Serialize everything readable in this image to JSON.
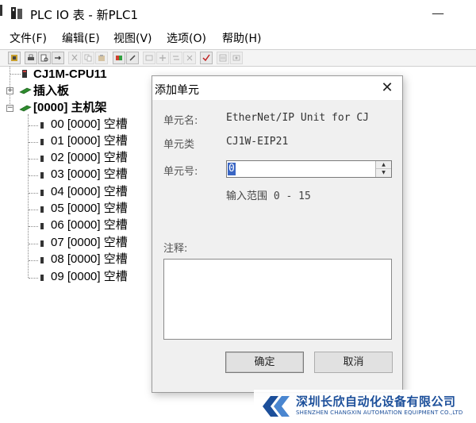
{
  "window": {
    "title": "PLC IO 表 - 新PLC1",
    "minimize": "—",
    "maximize": "□"
  },
  "menubar": {
    "items": [
      "文件(F)",
      "编辑(E)",
      "视图(V)",
      "选项(O)",
      "帮助(H)"
    ]
  },
  "toolbar": {
    "buttons": [
      "io-table",
      "print",
      "print-preview",
      "transfer",
      "cut",
      "copy",
      "paste",
      "compare",
      "edit",
      "insert-unit",
      "add-unit",
      "replace-unit",
      "delete-unit",
      "verify",
      "settings",
      "unit-info"
    ]
  },
  "tree": {
    "cpu": "CJ1M-CPU11",
    "insert_board": "插入板",
    "main_rack": "[0000] 主机架",
    "slots": [
      "00 [0000] 空槽",
      "01 [0000] 空槽",
      "02 [0000] 空槽",
      "03 [0000] 空槽",
      "04 [0000] 空槽",
      "05 [0000] 空槽",
      "06 [0000] 空槽",
      "07 [0000] 空槽",
      "08 [0000] 空槽",
      "09 [0000] 空槽"
    ]
  },
  "dialog": {
    "title": "添加单元",
    "close": "✕",
    "unit_name_label": "单元名:",
    "unit_name_value": "EtherNet/IP Unit for CJ",
    "unit_type_label": "单元类",
    "unit_type_value": "CJ1W-EIP21",
    "unit_no_label": "单元号:",
    "unit_no_value": "0",
    "range_hint": "输入范围 0 - 15",
    "comment_label": "注释:",
    "comment_value": "",
    "ok_button": "确定",
    "cancel_button": "取消"
  },
  "watermark": {
    "company_cn": "深圳长欣自动化设备有限公司",
    "company_en": "SHENZHEN CHANGXIN AUTOMATION EQUIPMENT CO.,LTD"
  },
  "colors": {
    "selection": "#3a66c4",
    "rack_icon": "#2e8b2e",
    "watermark": "#1c4f9a"
  }
}
